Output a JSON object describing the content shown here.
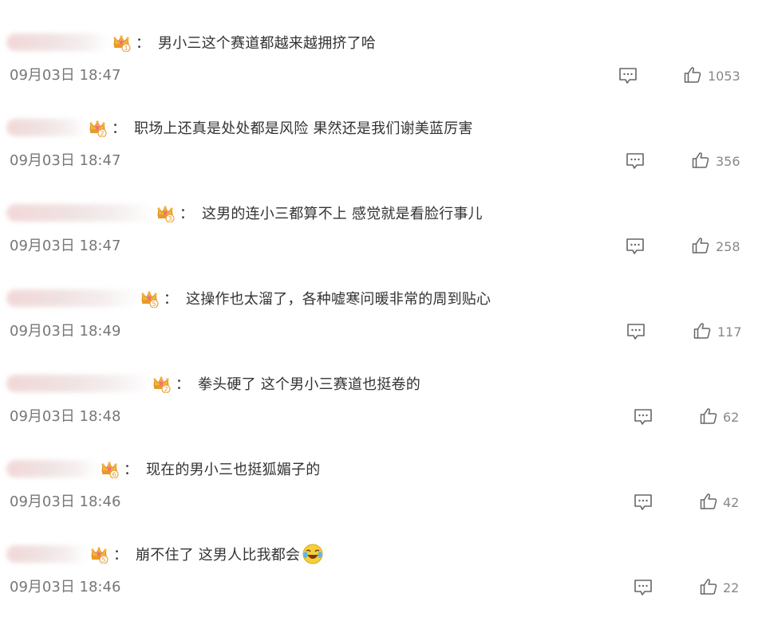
{
  "comments": [
    {
      "text": "男小三这个赛道都越来越拥挤了哈",
      "time": "09月03日 18:47",
      "likes": "1053",
      "badge_level": "1",
      "emoji": null
    },
    {
      "text": "职场上还真是处处都是风险 果然还是我们谢美蓝厉害",
      "time": "09月03日 18:47",
      "likes": "356",
      "badge_level": "2",
      "emoji": null
    },
    {
      "text": "这男的连小三都算不上 感觉就是看脸行事儿",
      "time": "09月03日 18:47",
      "likes": "258",
      "badge_level": "3",
      "emoji": null
    },
    {
      "text": "这操作也太溜了，各种嘘寒问暖非常的周到贴心",
      "time": "09月03日 18:49",
      "likes": "117",
      "badge_level": "5",
      "emoji": null
    },
    {
      "text": "拳头硬了 这个男小三赛道也挺卷的",
      "time": "09月03日 18:48",
      "likes": "62",
      "badge_level": "2",
      "emoji": null
    },
    {
      "text": "现在的男小三也挺狐媚子的",
      "time": "09月03日 18:46",
      "likes": "42",
      "badge_level": "6",
      "emoji": null
    },
    {
      "text": "崩不住了 这男人比我都会",
      "time": "09月03日 18:46",
      "likes": "22",
      "badge_level": "5",
      "emoji": "laughing-crying-emoji"
    }
  ],
  "colors": {
    "text": "#333333",
    "meta": "#777777",
    "badge_gold": "#f0a030",
    "badge_pink": "#f26a8d"
  },
  "icons": {
    "reply": "comment-reply-icon",
    "like": "thumbs-up-icon",
    "badge": "fan-crown-badge-icon"
  },
  "colon": "："
}
